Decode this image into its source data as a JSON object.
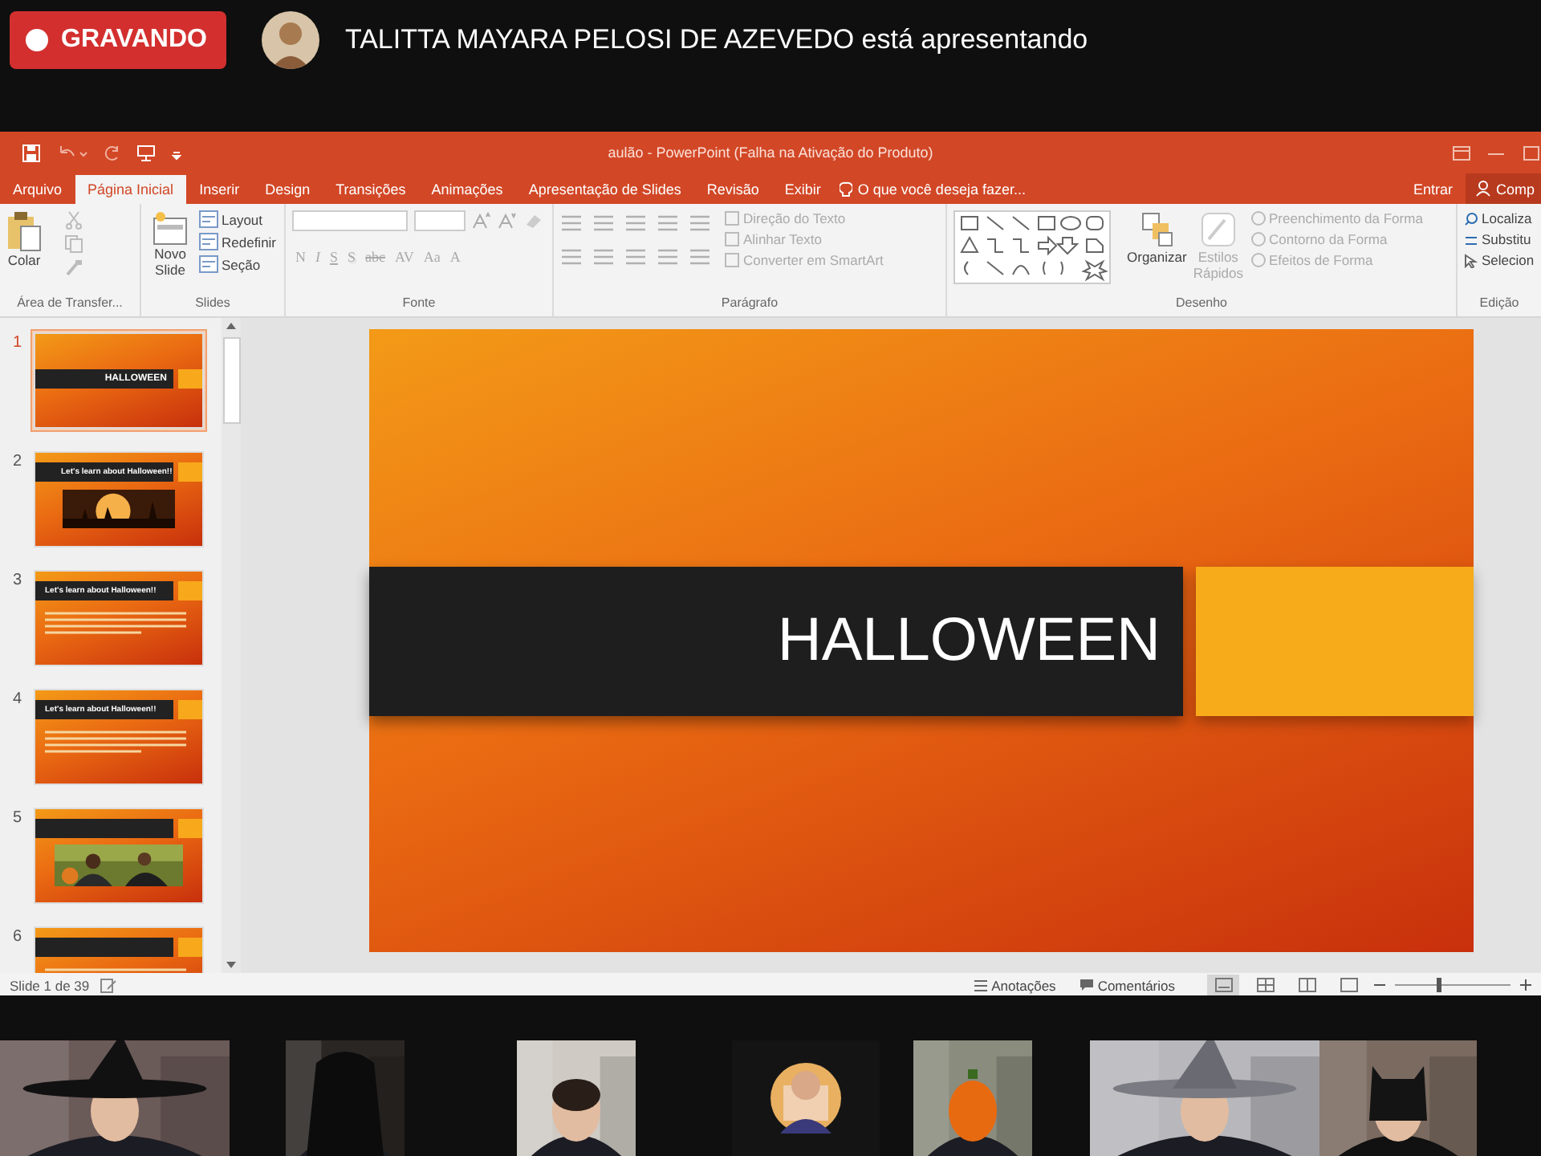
{
  "recording": {
    "label": "GRAVANDO"
  },
  "presenter": {
    "text": "TALITTA MAYARA PELOSI DE AZEVEDO está apresentando"
  },
  "powerpoint": {
    "title": "aulão - PowerPoint (Falha na Ativação do Produto)",
    "tabs": [
      {
        "label": "Arquivo",
        "selected": false
      },
      {
        "label": "Página Inicial",
        "selected": true
      },
      {
        "label": "Inserir",
        "selected": false
      },
      {
        "label": "Design",
        "selected": false
      },
      {
        "label": "Transições",
        "selected": false
      },
      {
        "label": "Animações",
        "selected": false
      },
      {
        "label": "Apresentação de Slides",
        "selected": false
      },
      {
        "label": "Revisão",
        "selected": false
      },
      {
        "label": "Exibir",
        "selected": false
      }
    ],
    "tell_me": "O que você deseja fazer...",
    "sign_in": "Entrar",
    "share": "Comp",
    "ribbon": {
      "clipboard": {
        "label": "Área de Transfer...",
        "paste": "Colar"
      },
      "slides": {
        "label": "Slides",
        "new_slide": [
          "Novo",
          "Slide"
        ],
        "items": [
          "Layout",
          "Redefinir",
          "Seção"
        ]
      },
      "font": {
        "label": "Fonte",
        "buttons": [
          "N",
          "I",
          "S",
          "S",
          "abc",
          "AV",
          "Aa",
          "A"
        ]
      },
      "paragraph": {
        "label": "Parágrafo",
        "items": [
          "Direção do Texto",
          "Alinhar Texto",
          "Converter em SmartArt"
        ]
      },
      "drawing": {
        "label": "Desenho",
        "arrange": "Organizar",
        "quick_styles": [
          "Estilos",
          "Rápidos"
        ],
        "items": [
          "Preenchimento da Forma",
          "Contorno da Forma",
          "Efeitos de Forma"
        ]
      },
      "editing": {
        "label": "Edição",
        "items": [
          "Localiza",
          "Substitu",
          "Selecion"
        ]
      }
    },
    "thumbnails": [
      {
        "number": "1",
        "selected": true,
        "kind": "title",
        "title": "HALLOWEEN"
      },
      {
        "number": "2",
        "selected": false,
        "title": "Let's learn about Halloween!!"
      },
      {
        "number": "3",
        "selected": false,
        "kind": "text",
        "title": "Let's learn about Halloween!!"
      },
      {
        "number": "4",
        "selected": false,
        "kind": "text",
        "title": "Let's learn about Halloween!!"
      },
      {
        "number": "5",
        "selected": false
      },
      {
        "number": "6",
        "selected": false,
        "kind": "text"
      }
    ],
    "slide": {
      "title": "HALLOWEEN"
    },
    "status_bar": {
      "slide_count": "Slide 1 de 39",
      "notes": "Anotações",
      "comments": "Comentários",
      "views": [
        {
          "selected": true
        },
        {
          "selected": false
        },
        {
          "selected": false
        },
        {
          "selected": false
        }
      ],
      "zoom": {
        "level": 0.37
      }
    }
  }
}
